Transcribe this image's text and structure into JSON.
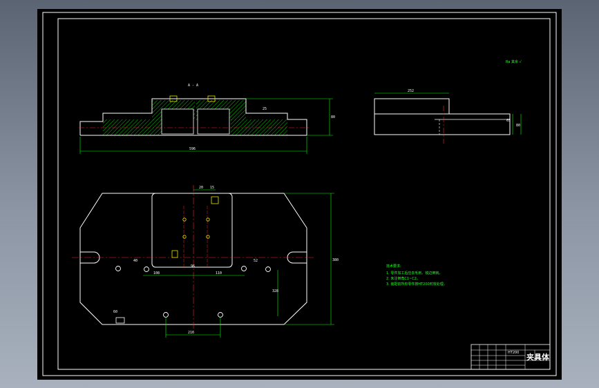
{
  "theme": {
    "outline": "#ffffff",
    "dimension": "#00ff00",
    "centerline": "#ff2020",
    "hatch": "#00ff00",
    "hole_yellow": "#e8e800",
    "paper": "#000000"
  },
  "drawing": {
    "section_label": "A - A",
    "dims": {
      "front_total": "596",
      "front_height": "80",
      "front_step": "25",
      "side_width": "252",
      "side_h1": "65",
      "side_h2": "80",
      "plan_top1": "20",
      "plan_top2": "15",
      "plan_c1": "108",
      "plan_c2": "110",
      "plan_c3": "96",
      "plan_right1": "52",
      "plan_left1": "40",
      "plan_vert": "328",
      "plan_bottom": "216",
      "plan_height": "380",
      "plan_side": "60"
    },
    "roughness": "Ra 其余 √",
    "notes_title": "技术要求:",
    "notes": [
      "1. 零件加工后应去毛刺、锐边倒钝。",
      "2. 未注倒角C1~C2。",
      "3. 装配前所有零件按HT200时效处理。"
    ],
    "title_block": {
      "part_name": "夹具体",
      "material": "HT200"
    }
  }
}
